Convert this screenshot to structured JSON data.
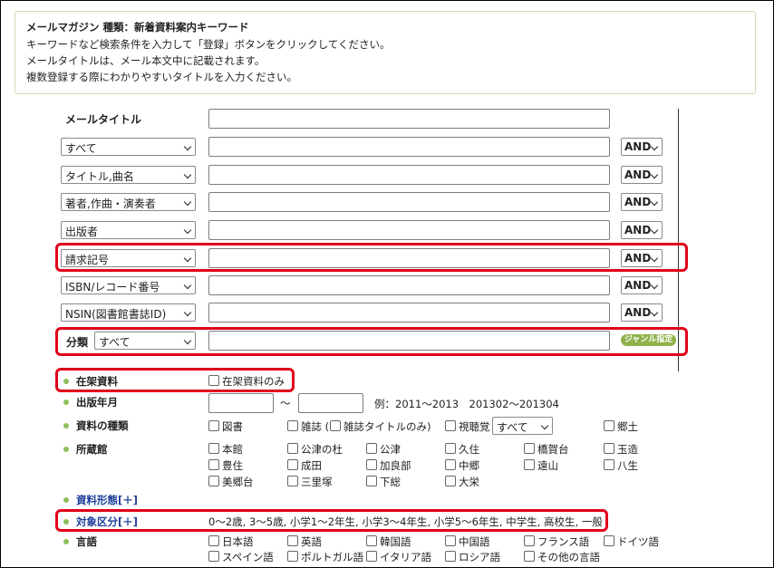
{
  "info": {
    "heading": "メールマガジン 種類：新着資料案内キーワード",
    "lines": [
      "キーワードなど検索条件を入力して「登録」ボタンをクリックしてください。",
      "メールタイトルは、メール本文中に記載されます。",
      "複数登録する際にわかりやすいタイトルを入力ください。"
    ]
  },
  "form": {
    "mail_title_label": "メールタイトル",
    "rows": [
      {
        "field": "すべて",
        "op": "AND"
      },
      {
        "field": "タイトル,曲名",
        "op": "AND"
      },
      {
        "field": "著者,作曲・演奏者",
        "op": "AND"
      },
      {
        "field": "出版者",
        "op": "AND"
      },
      {
        "field": "請求記号",
        "op": "AND"
      },
      {
        "field": "ISBN/レコード番号",
        "op": "AND"
      },
      {
        "field": "NSIN(図書館書誌ID)",
        "op": "AND"
      }
    ],
    "classification_label": "分類",
    "classification_value": "すべて",
    "genre_button": "ジャンル指定"
  },
  "filters": {
    "availability": {
      "label": "在架資料",
      "option": "在架資料のみ"
    },
    "pub_year": {
      "label": "出版年月",
      "tilde": "～",
      "example": "例：2011～2013　201302～201304"
    },
    "material_type": {
      "label": "資料の種類",
      "book": "図書",
      "magazine": "雑誌 (",
      "magazine_only": "雑誌タイトルのみ)",
      "av": "視聴覚",
      "av_select": "すべて",
      "local": "郷土"
    },
    "library": {
      "label": "所蔵館",
      "items": [
        "本館",
        "公津の杜",
        "公津",
        "久住",
        "橋賀台",
        "玉造",
        "豊住",
        "成田",
        "加良部",
        "中郷",
        "遠山",
        "八生",
        "美郷台",
        "三里塚",
        "下総",
        "大栄"
      ]
    },
    "format": {
      "label": "資料形態[＋]"
    },
    "target": {
      "label": "対象区分[＋]",
      "values": "0～2歳, 3～5歳, 小学1～2年生, 小学3～4年生, 小学5～6年生, 中学生, 高校生, 一般"
    },
    "language": {
      "label": "言語",
      "items": [
        "日本語",
        "英語",
        "韓国語",
        "中国語",
        "フランス語",
        "ドイツ語",
        "スペイン語",
        "ポルトガル語",
        "イタリア語",
        "ロシア語",
        "その他の言語"
      ]
    }
  },
  "colors": {
    "highlight": "#e0001a",
    "accent_dot": "#8ebf5a",
    "genre": "#8fb14a",
    "link": "#1f3f9a"
  }
}
